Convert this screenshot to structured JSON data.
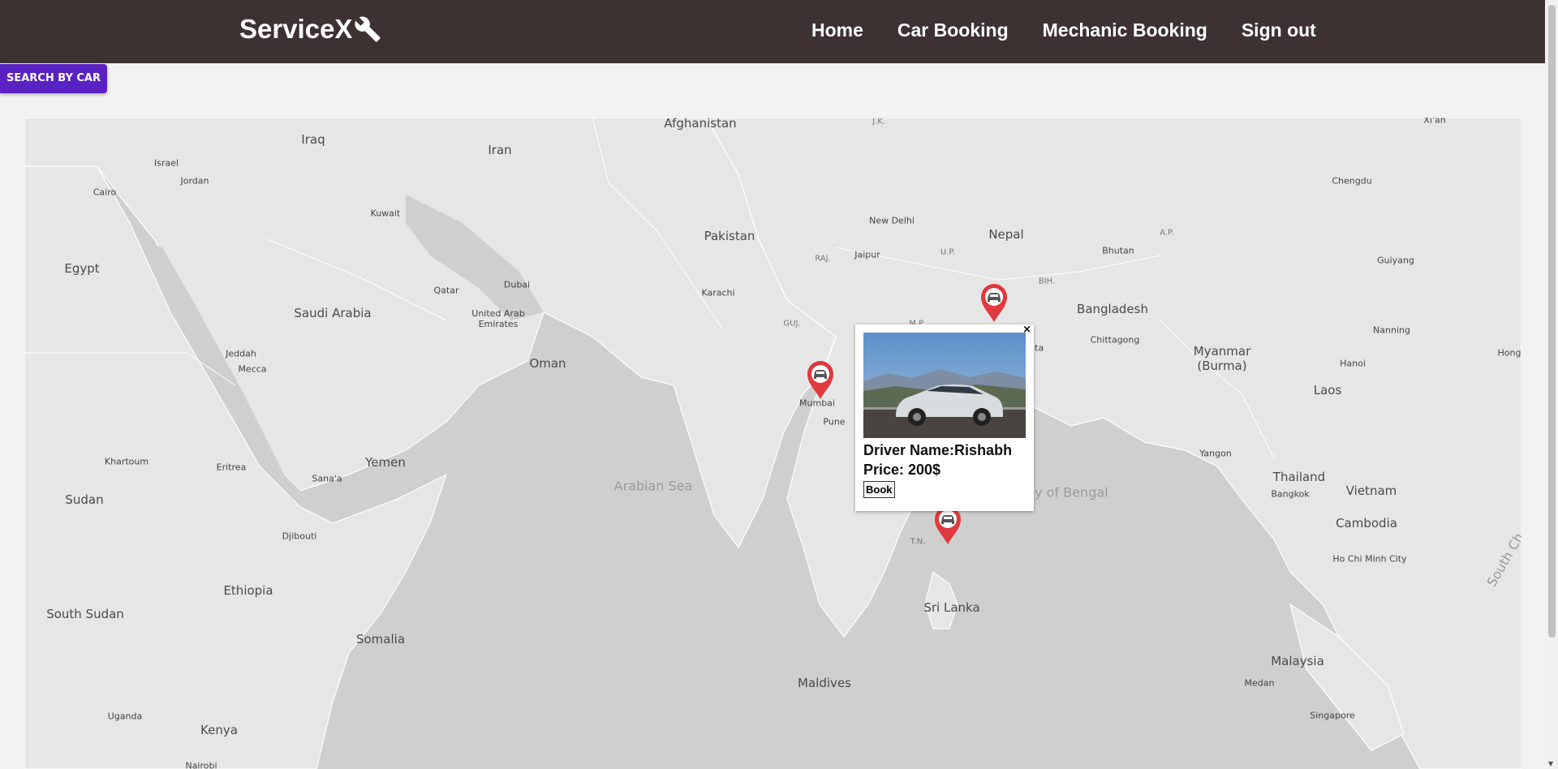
{
  "navbar": {
    "brand": "ServiceX",
    "links": [
      "Home",
      "Car Booking",
      "Mechanic Booking",
      "Sign out"
    ]
  },
  "search_button": "SEARCH BY CAR",
  "map": {
    "country_labels": [
      "Afghanistan",
      "Iraq",
      "Iran",
      "Egypt",
      "Saudi Arabia",
      "Pakistan",
      "Nepal",
      "Bangladesh",
      "Oman",
      "Yemen",
      "Sudan",
      "Ethiopia",
      "South Sudan",
      "Somalia",
      "Kenya",
      "Uganda",
      "Myanmar (Burma)",
      "Laos",
      "Thailand",
      "Vietnam",
      "Cambodia",
      "Malaysia",
      "Sri Lanka",
      "Maldives",
      "Bhutan",
      "Singapore"
    ],
    "city_labels": [
      "Israel",
      "Jordan",
      "Cairo",
      "Kuwait",
      "Qatar",
      "Dubai",
      "United Arab Emirates",
      "Karachi",
      "Jeddah",
      "Mecca",
      "Khartoum",
      "Eritrea",
      "Sana'a",
      "Djibouti",
      "Mumbai",
      "Pune",
      "New Delhi",
      "Jaipur",
      "Kolkata",
      "Chittagong",
      "Yangon",
      "Bangkok",
      "Ho Chi Minh City",
      "Hanoi",
      "Nanning",
      "Guiyang",
      "Chengdu",
      "Xi'an",
      "Medan",
      "Nairobi",
      "Hong"
    ],
    "region_labels": [
      "J.K.",
      "RAJ.",
      "U.P.",
      "BIH.",
      "GUJ.",
      "M.P.",
      "A.P.",
      "T.N."
    ],
    "seas": [
      "Arabian Sea",
      "Bay of Bengal",
      "South Ch"
    ]
  },
  "popup": {
    "driver": "Driver Name:Rishabh",
    "price": "Price: 200$",
    "book": "Book",
    "close": "×"
  },
  "colors": {
    "navbar": "#3d3131",
    "accent": "#5a22c3",
    "marker": "#e0393e"
  }
}
